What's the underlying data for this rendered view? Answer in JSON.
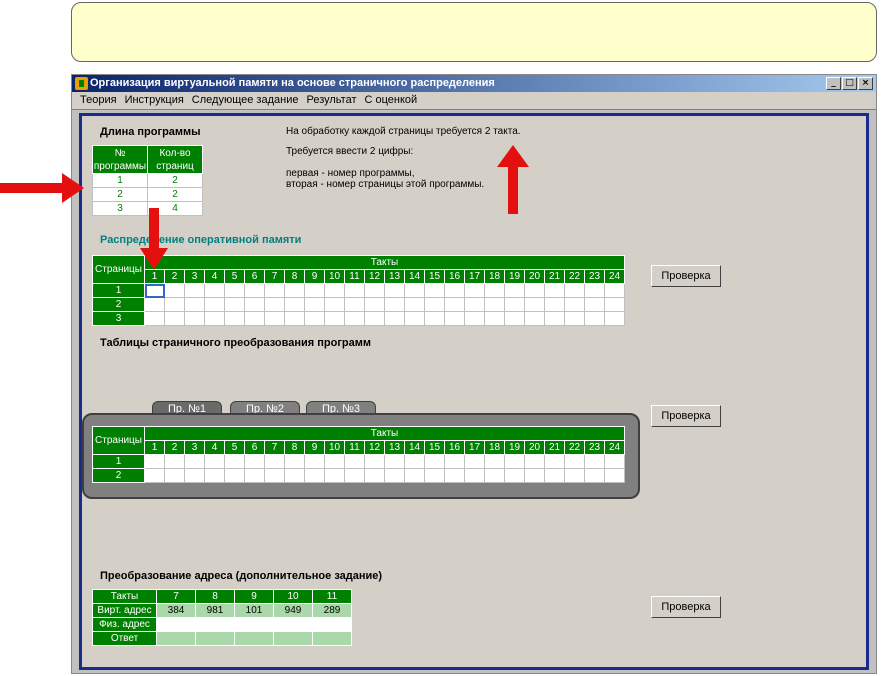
{
  "window": {
    "title": "Организация виртуальной памяти на основе страничного распределения",
    "btn_min": "_",
    "btn_max": "□",
    "btn_close": "×"
  },
  "menu": [
    "Теория",
    "Инструкция",
    "Следующее задание",
    "Результат",
    "С оценкой"
  ],
  "program_length": {
    "title": "Длина программы",
    "col1": "№ программы",
    "col2": "Кол-во страниц",
    "rows": [
      [
        "1",
        "2"
      ],
      [
        "2",
        "2"
      ],
      [
        "3",
        "4"
      ]
    ]
  },
  "info": {
    "line1": "На обработку каждой страницы требуется 2 такта.",
    "line2": "Требуется ввести 2 цифры:",
    "line3": "первая - номер программы,",
    "line4": "вторая - номер страницы этой программы."
  },
  "ram": {
    "title": "Распределение оперативной памяти",
    "pages_label": "Страницы",
    "ticks_label": "Такты",
    "ticks": [
      "1",
      "2",
      "3",
      "4",
      "5",
      "6",
      "7",
      "8",
      "9",
      "10",
      "11",
      "12",
      "13",
      "14",
      "15",
      "16",
      "17",
      "18",
      "19",
      "20",
      "21",
      "22",
      "23",
      "24"
    ],
    "rows": [
      "1",
      "2",
      "3"
    ],
    "check": "Проверка"
  },
  "page_tables": {
    "title": "Таблицы страничного преобразования программ",
    "tabs": [
      "Пр. №1",
      "Пр. №2",
      "Пр. №3"
    ],
    "pages_label": "Страницы",
    "ticks_label": "Такты",
    "rows": [
      "1",
      "2"
    ],
    "check": "Проверка"
  },
  "address": {
    "title": "Преобразование адреса (дополнительное задание)",
    "row_labels": [
      "Такты",
      "Вирт. адрес",
      "Физ. адрес",
      "Ответ"
    ],
    "ticks": [
      "7",
      "8",
      "9",
      "10",
      "11"
    ],
    "virt": [
      "384",
      "981",
      "101",
      "949",
      "289"
    ],
    "check": "Проверка"
  }
}
